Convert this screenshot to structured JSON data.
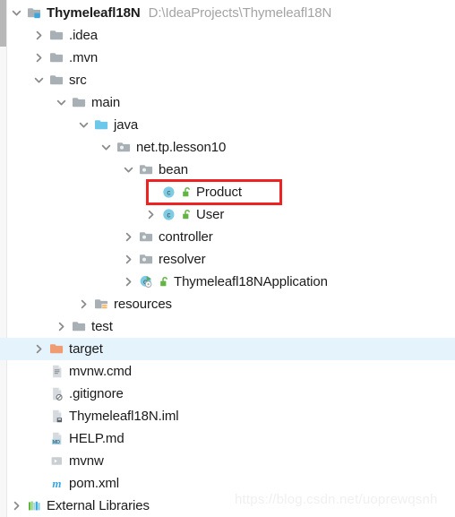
{
  "window": {
    "title": "Project tool window",
    "watermark": "https://blog.csdn.net/uoprewqsnh"
  },
  "colors": {
    "selection_bg": "#e5f3fc",
    "highlight_border": "#ee2222",
    "folder_gray": "#a9b0b5",
    "folder_source_cyan": "#6cc8ea",
    "folder_target_orange": "#ef9c72",
    "class_icon_blue": "#70c6e0",
    "lock_green": "#62b543",
    "maven_blue": "#4aa5d4",
    "path_text": "#a4a4a4"
  },
  "tree": {
    "rows": [
      {
        "id": "project-root",
        "label": "Thymeleafl18N",
        "secondary": "D:\\IdeaProjects\\Thymeleafl18N",
        "depth": 0,
        "arrow": "expanded",
        "icon": "module-folder-icon",
        "bold": true,
        "selected": false,
        "highlighted": false
      },
      {
        "id": "idea",
        "label": ".idea",
        "secondary": "",
        "depth": 1,
        "arrow": "collapsed",
        "icon": "folder-icon",
        "bold": false,
        "selected": false,
        "highlighted": false
      },
      {
        "id": "mvn",
        "label": ".mvn",
        "secondary": "",
        "depth": 1,
        "arrow": "collapsed",
        "icon": "folder-icon",
        "bold": false,
        "selected": false,
        "highlighted": false
      },
      {
        "id": "src",
        "label": "src",
        "secondary": "",
        "depth": 1,
        "arrow": "expanded",
        "icon": "folder-icon",
        "bold": false,
        "selected": false,
        "highlighted": false
      },
      {
        "id": "main",
        "label": "main",
        "secondary": "",
        "depth": 2,
        "arrow": "expanded",
        "icon": "folder-icon",
        "bold": false,
        "selected": false,
        "highlighted": false
      },
      {
        "id": "java",
        "label": "java",
        "secondary": "",
        "depth": 3,
        "arrow": "expanded",
        "icon": "source-folder-icon",
        "bold": false,
        "selected": false,
        "highlighted": false
      },
      {
        "id": "package-net-tp-lesson10",
        "label": "net.tp.lesson10",
        "secondary": "",
        "depth": 4,
        "arrow": "expanded",
        "icon": "package-icon",
        "bold": false,
        "selected": false,
        "highlighted": false
      },
      {
        "id": "package-bean",
        "label": "bean",
        "secondary": "",
        "depth": 5,
        "arrow": "expanded",
        "icon": "package-icon",
        "bold": false,
        "selected": false,
        "highlighted": false
      },
      {
        "id": "class-product",
        "label": "Product",
        "secondary": "",
        "depth": 6,
        "arrow": "none",
        "icon": "java-class-icon",
        "lock": true,
        "bold": false,
        "selected": false,
        "highlighted": true
      },
      {
        "id": "class-user",
        "label": "User",
        "secondary": "",
        "depth": 6,
        "arrow": "collapsed",
        "icon": "java-class-icon",
        "lock": true,
        "bold": false,
        "selected": false,
        "highlighted": false
      },
      {
        "id": "package-controller",
        "label": "controller",
        "secondary": "",
        "depth": 5,
        "arrow": "collapsed",
        "icon": "package-icon",
        "bold": false,
        "selected": false,
        "highlighted": false
      },
      {
        "id": "package-resolver",
        "label": "resolver",
        "secondary": "",
        "depth": 5,
        "arrow": "collapsed",
        "icon": "package-icon",
        "bold": false,
        "selected": false,
        "highlighted": false
      },
      {
        "id": "class-thymeleafl18napplication",
        "label": "Thymeleafl18NApplication",
        "secondary": "",
        "depth": 5,
        "arrow": "collapsed",
        "icon": "java-runnable-class-icon",
        "lock": true,
        "bold": false,
        "selected": false,
        "highlighted": false
      },
      {
        "id": "resources",
        "label": "resources",
        "secondary": "",
        "depth": 3,
        "arrow": "collapsed",
        "icon": "resources-folder-icon",
        "bold": false,
        "selected": false,
        "highlighted": false
      },
      {
        "id": "test",
        "label": "test",
        "secondary": "",
        "depth": 2,
        "arrow": "collapsed",
        "icon": "folder-icon",
        "bold": false,
        "selected": false,
        "highlighted": false
      },
      {
        "id": "target",
        "label": "target",
        "secondary": "",
        "depth": 1,
        "arrow": "collapsed",
        "icon": "excluded-folder-icon",
        "bold": false,
        "selected": true,
        "highlighted": false
      },
      {
        "id": "file-mvnw-cmd",
        "label": "mvnw.cmd",
        "secondary": "",
        "depth": 1,
        "arrow": "none",
        "icon": "text-file-icon",
        "bold": false,
        "selected": false,
        "highlighted": false
      },
      {
        "id": "file-gitignore",
        "label": ".gitignore",
        "secondary": "",
        "depth": 1,
        "arrow": "none",
        "icon": "gitignore-file-icon",
        "bold": false,
        "selected": false,
        "highlighted": false
      },
      {
        "id": "file-iml",
        "label": "Thymeleafl18N.iml",
        "secondary": "",
        "depth": 1,
        "arrow": "none",
        "icon": "iml-file-icon",
        "bold": false,
        "selected": false,
        "highlighted": false
      },
      {
        "id": "file-help-md",
        "label": "HELP.md",
        "secondary": "",
        "depth": 1,
        "arrow": "none",
        "icon": "markdown-file-icon",
        "bold": false,
        "selected": false,
        "highlighted": false
      },
      {
        "id": "file-mvnw",
        "label": "mvnw",
        "secondary": "",
        "depth": 1,
        "arrow": "none",
        "icon": "shell-script-icon",
        "bold": false,
        "selected": false,
        "highlighted": false
      },
      {
        "id": "file-pom-xml",
        "label": "pom.xml",
        "secondary": "",
        "depth": 1,
        "arrow": "none",
        "icon": "maven-pom-icon",
        "bold": false,
        "selected": false,
        "highlighted": false
      },
      {
        "id": "external-libraries",
        "label": "External Libraries",
        "secondary": "",
        "depth": 0,
        "arrow": "collapsed",
        "icon": "external-libraries-icon",
        "bold": false,
        "selected": false,
        "highlighted": false
      }
    ]
  }
}
